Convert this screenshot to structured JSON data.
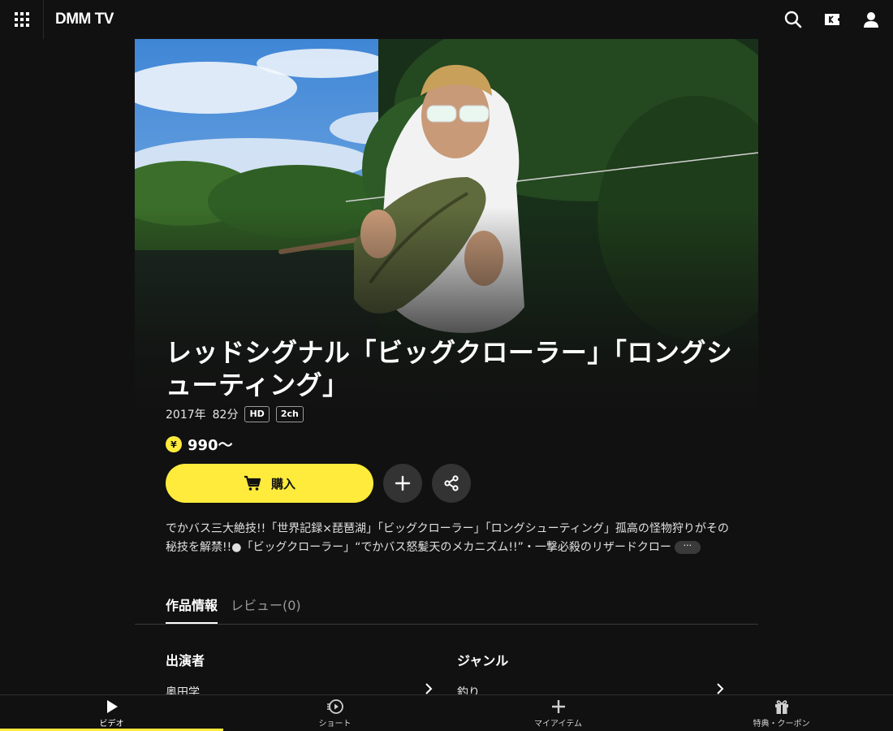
{
  "header": {
    "logo": "DMM TV",
    "icons": [
      "grid-menu-icon",
      "search-icon",
      "ticket-icon",
      "user-icon"
    ]
  },
  "title": "レッドシグナル「ビッグクローラー」「ロングシューティング」",
  "meta": {
    "year": "2017年",
    "duration": "82分",
    "badges": [
      "HD",
      "2ch"
    ]
  },
  "price": {
    "symbol": "¥",
    "value": "990〜"
  },
  "actions": {
    "buy_label": "購入",
    "add_icon": "plus-icon",
    "share_icon": "share-icon"
  },
  "description": {
    "text": "でかバス三大絶技!!「世界記録×琵琶湖」「ビッグクローラー」「ロングシューティング」孤高の怪物狩りがその秘技を解禁!!●「ビッグクローラー」“でかバス怒髪天のメカニズム!!”・一撃必殺のリザードクロー",
    "more_label": "···"
  },
  "tabs": [
    {
      "label": "作品情報",
      "active": true
    },
    {
      "label": "レビュー(0)",
      "active": false
    }
  ],
  "sections": {
    "cast": {
      "heading": "出演者",
      "items": [
        "奥田学"
      ]
    },
    "genre": {
      "heading": "ジャンル",
      "items": [
        "釣り"
      ]
    }
  },
  "bottom_nav": [
    {
      "label": "ビデオ",
      "icon": "play-icon",
      "active": true
    },
    {
      "label": "ショート",
      "icon": "short-icon",
      "active": false
    },
    {
      "label": "マイアイテム",
      "icon": "plus-icon",
      "active": false
    },
    {
      "label": "特典・クーポン",
      "icon": "gift-icon",
      "active": false
    }
  ],
  "colors": {
    "background": "#111111",
    "accent": "#ffeb3b",
    "button_gray": "#333333"
  }
}
